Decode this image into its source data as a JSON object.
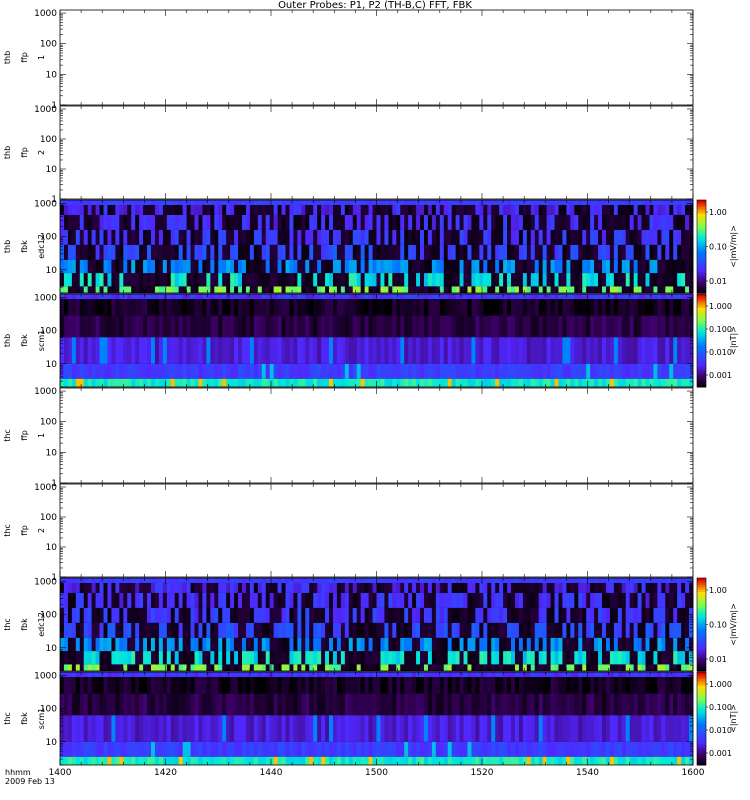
{
  "title": "Outer Probes: P1, P2 (TH-B,C) FFT, FBK",
  "footer": {
    "time_label": "hhmm",
    "date_label": "2009 Feb 13"
  },
  "x_ticks": [
    "1400",
    "1420",
    "1440",
    "1500",
    "1520",
    "1540",
    "1600"
  ],
  "chart_data": [
    {
      "type": "heatmap",
      "panel": "thb-ffp1",
      "ylabel": [
        "thb",
        "ffp",
        "1"
      ],
      "y_scale": "log",
      "yticks": [
        "1",
        "10",
        "100",
        "1000"
      ],
      "has_data": false
    },
    {
      "type": "heatmap",
      "panel": "thb-ffp2",
      "ylabel": [
        "thb",
        "ffp",
        "2"
      ],
      "y_scale": "log",
      "yticks": [
        "1",
        "10",
        "100",
        "1000"
      ],
      "has_data": false
    },
    {
      "type": "heatmap",
      "panel": "thb-fbk-edc12",
      "ylabel": [
        "thb",
        "fbk",
        "edc12"
      ],
      "y_scale": "log",
      "yticks": [
        "10",
        "100",
        "1000"
      ],
      "has_data": true,
      "colorbar": {
        "label": "<|mV/m|>",
        "ticks": [
          "1.00",
          "0.10",
          "0.01"
        ],
        "scale": "log"
      }
    },
    {
      "type": "heatmap",
      "panel": "thb-fbk-scm1",
      "ylabel": [
        "thb",
        "fbk",
        "scm1"
      ],
      "y_scale": "log",
      "yticks": [
        "10",
        "100",
        "1000"
      ],
      "has_data": true,
      "colorbar": {
        "label": "<|nT|>",
        "ticks": [
          "1.000",
          "0.100",
          "0.010",
          "0.001"
        ],
        "scale": "log"
      }
    },
    {
      "type": "heatmap",
      "panel": "thc-ffp1",
      "ylabel": [
        "thc",
        "ffp",
        "1"
      ],
      "y_scale": "log",
      "yticks": [
        "1",
        "10",
        "100",
        "1000"
      ],
      "has_data": false
    },
    {
      "type": "heatmap",
      "panel": "thc-ffp2",
      "ylabel": [
        "thc",
        "ffp",
        "2"
      ],
      "y_scale": "log",
      "yticks": [
        "1",
        "10",
        "100",
        "1000"
      ],
      "has_data": false
    },
    {
      "type": "heatmap",
      "panel": "thc-fbk-edc12",
      "ylabel": [
        "thc",
        "fbk",
        "edc12"
      ],
      "y_scale": "log",
      "yticks": [
        "10",
        "100",
        "1000"
      ],
      "has_data": true,
      "colorbar": {
        "label": "<|mV/m|>",
        "ticks": [
          "1.00",
          "0.10",
          "0.01"
        ],
        "scale": "log"
      }
    },
    {
      "type": "heatmap",
      "panel": "thc-fbk-scm1",
      "ylabel": [
        "thc",
        "fbk",
        "scm1"
      ],
      "y_scale": "log",
      "yticks": [
        "10",
        "100",
        "1000"
      ],
      "has_data": true,
      "colorbar": {
        "label": "<|nT|>",
        "ticks": [
          "1.000",
          "0.100",
          "0.010",
          "0.001"
        ],
        "scale": "log"
      }
    }
  ],
  "colors": {
    "background": "#ffffff",
    "axis": "#000000",
    "no_data": "#000000"
  }
}
